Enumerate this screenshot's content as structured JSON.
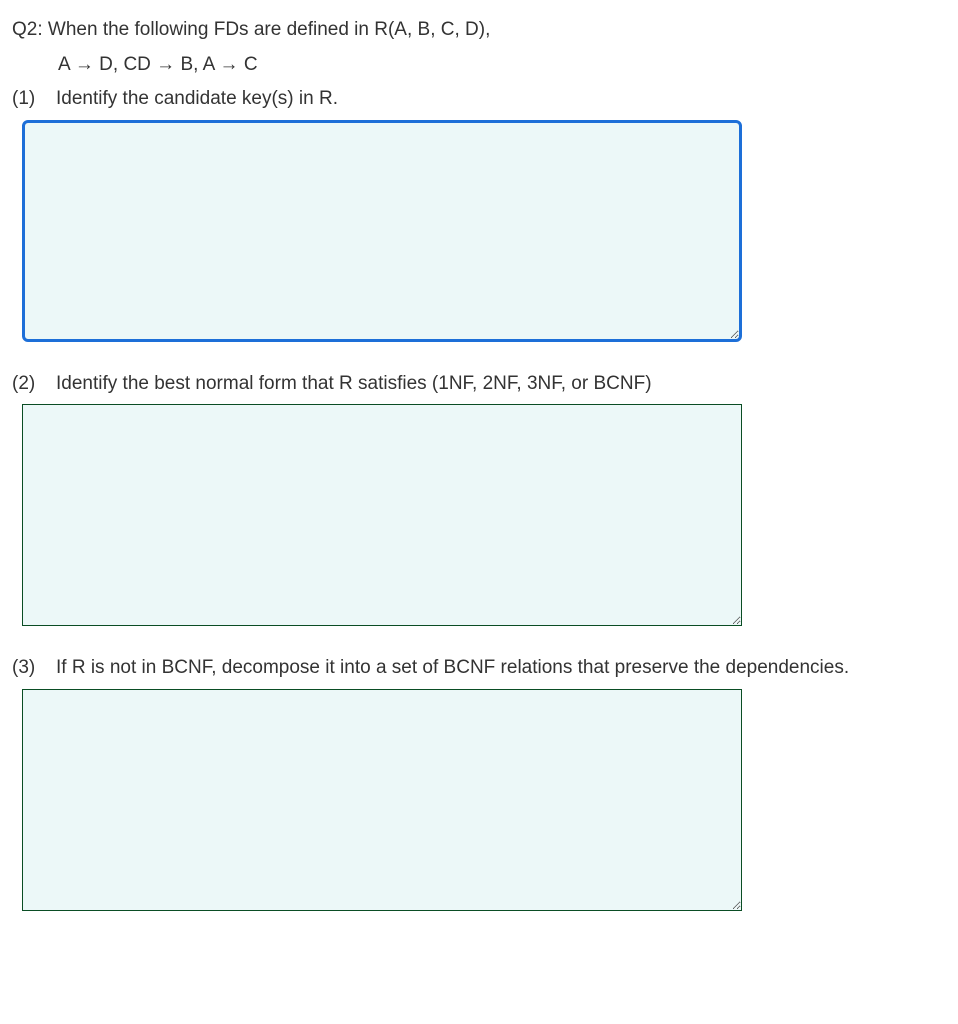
{
  "question": {
    "heading": "Q2: When the following FDs are defined in R(A, B, C, D),",
    "fds": "A → D, CD → B, A → C"
  },
  "parts": [
    {
      "num": "(1)",
      "prompt": "Identify the candidate key(s) in R.",
      "value": "",
      "focused": true
    },
    {
      "num": "(2)",
      "prompt": "Identify the best normal form that R satisfies (1NF, 2NF, 3NF, or BCNF)",
      "value": "",
      "focused": false
    },
    {
      "num": "(3)",
      "prompt": "If R is not in BCNF, decompose it into a set of BCNF relations that preserve the dependencies.",
      "value": "",
      "focused": false
    }
  ]
}
